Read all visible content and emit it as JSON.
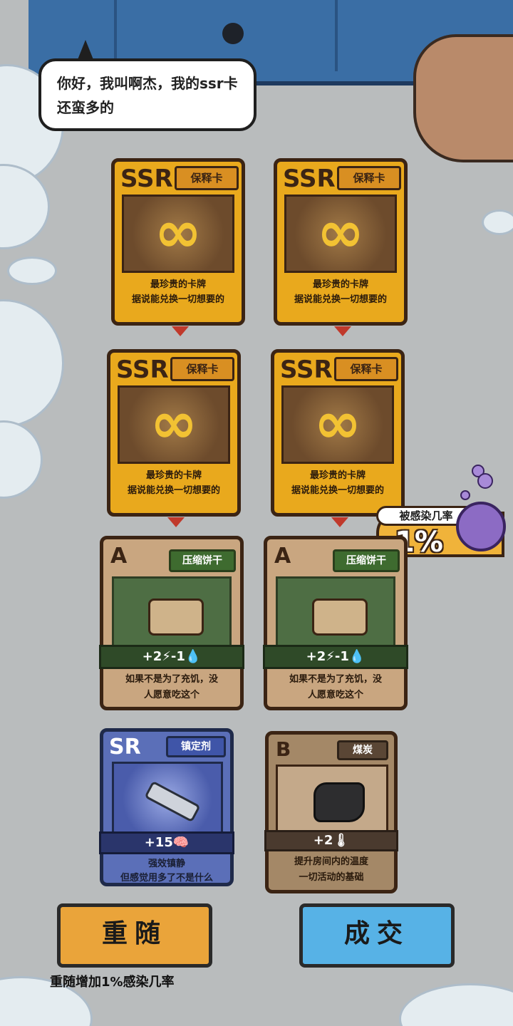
{
  "dialog": {
    "speech": "你好，我叫啊杰，我的ssr卡还蛮多的"
  },
  "infection": {
    "label": "被感染几率",
    "value": "1%"
  },
  "cards": [
    {
      "rank": "SSR",
      "tag": "保释卡",
      "icon": "infinity-icon",
      "desc_line1": "最珍贵的卡牌",
      "desc_line2": "据说能兑换一切想要的"
    },
    {
      "rank": "SSR",
      "tag": "保释卡",
      "icon": "infinity-icon",
      "desc_line1": "最珍贵的卡牌",
      "desc_line2": "据说能兑换一切想要的"
    },
    {
      "rank": "SSR",
      "tag": "保释卡",
      "icon": "infinity-icon",
      "desc_line1": "最珍贵的卡牌",
      "desc_line2": "据说能兑换一切想要的"
    },
    {
      "rank": "SSR",
      "tag": "保释卡",
      "icon": "infinity-icon",
      "desc_line1": "最珍贵的卡牌",
      "desc_line2": "据说能兑换一切想要的"
    },
    {
      "rank": "A",
      "tag": "压缩饼干",
      "icon": "biscuit-icon",
      "stats": "+2⚡-1💧",
      "desc_line1": "如果不是为了充饥，没",
      "desc_line2": "人愿意吃这个"
    },
    {
      "rank": "A",
      "tag": "压缩饼干",
      "icon": "biscuit-icon",
      "stats": "+2⚡-1💧",
      "desc_line1": "如果不是为了充饥，没",
      "desc_line2": "人愿意吃这个"
    },
    {
      "rank": "SR",
      "tag": "镇定剂",
      "icon": "syringe-icon",
      "stats": "+15🧠",
      "desc_line1": "强效镇静",
      "desc_line2": "但感觉用多了不是什么"
    },
    {
      "rank": "B",
      "tag": "煤炭",
      "icon": "coal-icon",
      "stats": "+2🌡",
      "desc_line1": "提升房间内的温度",
      "desc_line2": "一切活动的基础"
    }
  ],
  "actions": {
    "reroll": "重随",
    "deal": "成交",
    "reroll_hint": "重随增加1%感染几率"
  },
  "colors": {
    "ssr_card": "#e9a91d",
    "a_card": "#c9a680",
    "sr_card": "#5b6fb8",
    "b_card": "#a48867",
    "reroll_button": "#eaa43a",
    "deal_button": "#57b2e6"
  }
}
